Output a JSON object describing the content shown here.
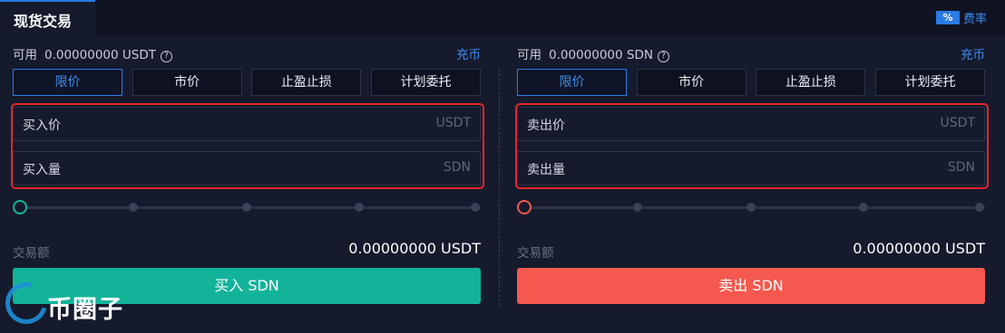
{
  "header": {
    "tab_spot": "现货交易",
    "fee_icon": "%",
    "fee_label": "费率"
  },
  "buy": {
    "available_label": "可用",
    "available_value": "0.00000000 USDT",
    "deposit": "充币",
    "order_tabs": [
      "限价",
      "市价",
      "止盈止损",
      "计划委托"
    ],
    "active_tab": "限价",
    "price_label": "买入价",
    "price_unit": "USDT",
    "qty_label": "买入量",
    "qty_unit": "SDN",
    "slider_percent": 0,
    "amount_label": "交易额",
    "amount_value": "0.00000000 USDT",
    "button": "买入 SDN",
    "accent": "#13b39a"
  },
  "sell": {
    "available_label": "可用",
    "available_value": "0.00000000 SDN",
    "deposit": "充币",
    "order_tabs": [
      "限价",
      "市价",
      "止盈止损",
      "计划委托"
    ],
    "active_tab": "限价",
    "price_label": "卖出价",
    "price_unit": "USDT",
    "qty_label": "卖出量",
    "qty_unit": "SDN",
    "slider_percent": 0,
    "amount_label": "交易额",
    "amount_value": "0.00000000 USDT",
    "button": "卖出 SDN",
    "accent": "#f4584e"
  },
  "watermark": {
    "text": "币圈子"
  },
  "colors": {
    "background": "#151a2c",
    "active_tab": "#2c7be5",
    "link": "#3d8ef0",
    "highlight_box": "#e3262c"
  }
}
